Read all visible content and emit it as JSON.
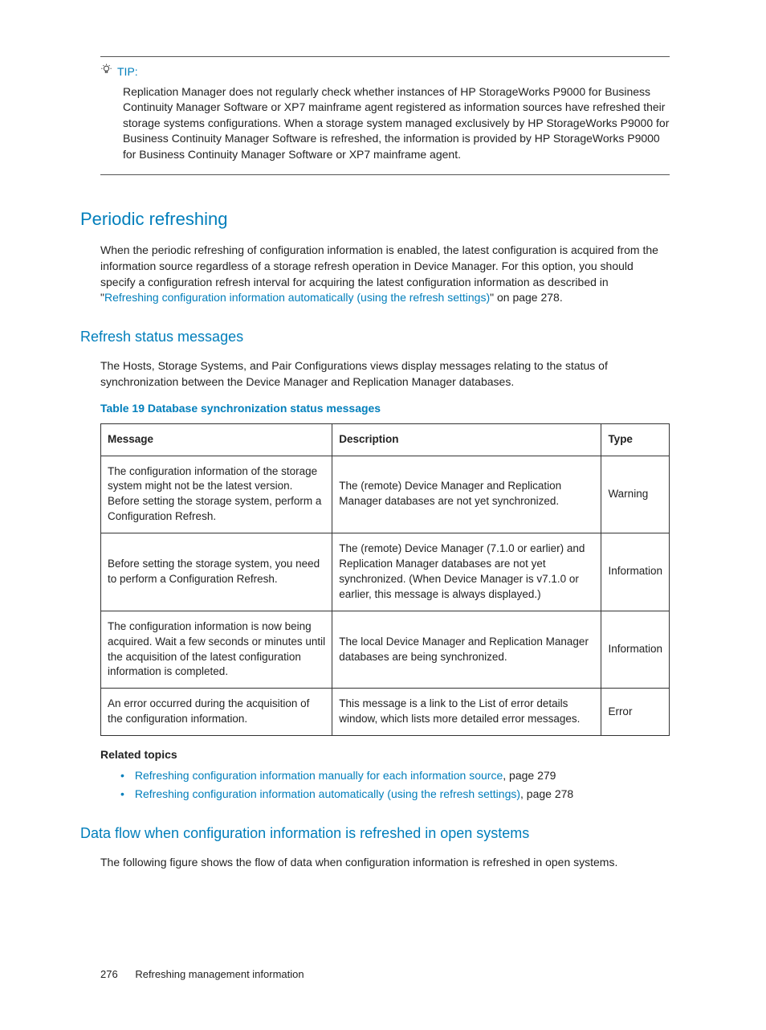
{
  "tip": {
    "label": "TIP:",
    "body": "Replication Manager does not regularly check whether instances of HP StorageWorks P9000 for Business Continuity Manager Software or XP7 mainframe agent registered as information sources have refreshed their storage systems configurations. When a storage system managed exclusively by HP StorageWorks P9000 for Business Continuity Manager Software is refreshed, the information is provided by HP StorageWorks P9000 for Business Continuity Manager Software or XP7 mainframe agent."
  },
  "periodic": {
    "heading": "Periodic refreshing",
    "body_pre": "When the periodic refreshing of configuration information is enabled, the latest configuration is acquired from the information source regardless of a storage refresh operation in Device Manager. For this option, you should specify a configuration refresh interval for acquiring the latest configuration information as described in \"",
    "link": "Refreshing configuration information automatically (using the refresh settings)",
    "body_post": "\" on page 278."
  },
  "refresh_status": {
    "heading": "Refresh status messages",
    "intro": "The Hosts, Storage Systems, and Pair Configurations views display messages relating to the status of synchronization between the Device Manager and Replication Manager databases.",
    "table_caption": "Table 19 Database synchronization status messages",
    "headers": {
      "c1": "Message",
      "c2": "Description",
      "c3": "Type"
    },
    "rows": [
      {
        "msg": "The configuration information of the storage system might not be the latest version. Before setting the storage system, perform a Configuration Refresh.",
        "desc": "The (remote) Device Manager and Replication Manager databases are not yet synchronized.",
        "type": "Warning"
      },
      {
        "msg": "Before setting the storage system, you need to perform a Configuration Refresh.",
        "desc": "The (remote) Device Manager (7.1.0 or earlier) and Replication Manager databases are not yet synchronized. (When Device Manager is v7.1.0 or earlier, this message is always displayed.)",
        "type": "Information"
      },
      {
        "msg": "The configuration information is now being acquired. Wait a few seconds or minutes until the acquisition of the latest configuration information is completed.",
        "desc": "The local Device Manager and Replication Manager databases are being synchronized.",
        "type": "Information"
      },
      {
        "msg": "An error occurred during the acquisition of the configuration information.",
        "desc": "This message is a link to the List of error details window, which lists more detailed error messages.",
        "type": "Error"
      }
    ]
  },
  "related": {
    "heading": "Related topics",
    "items": [
      {
        "link": "Refreshing configuration information manually for each information source",
        "suffix": ", page 279"
      },
      {
        "link": "Refreshing configuration information automatically (using the refresh settings)",
        "suffix": ", page 278"
      }
    ]
  },
  "dataflow": {
    "heading": "Data flow when configuration information is refreshed in open systems",
    "body": "The following figure shows the flow of data when configuration information is refreshed in open systems."
  },
  "footer": {
    "page": "276",
    "title": "Refreshing management information"
  }
}
